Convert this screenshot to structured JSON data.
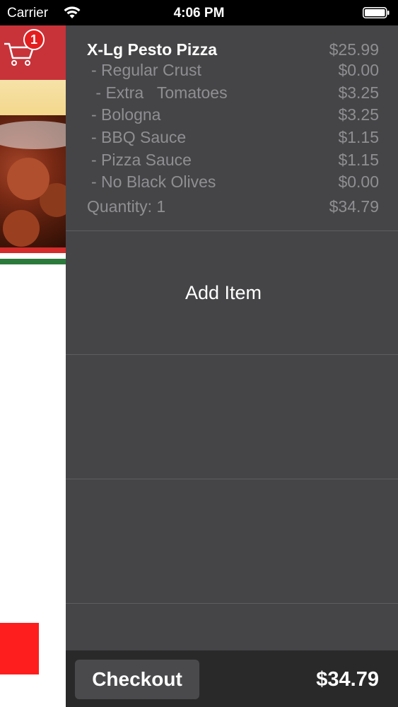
{
  "status_bar": {
    "carrier": "Carrier",
    "time": "4:06 PM"
  },
  "cart": {
    "badge_count": "1"
  },
  "order": {
    "item_name": "X-Lg Pesto Pizza",
    "item_price": "$25.99",
    "options": [
      {
        "label": " - Regular Crust",
        "price": "$0.00"
      },
      {
        "label": " - Extra   Tomatoes",
        "price": "$3.25"
      },
      {
        "label": " - Bologna",
        "price": "$3.25"
      },
      {
        "label": " - BBQ Sauce",
        "price": "$1.15"
      },
      {
        "label": " - Pizza Sauce",
        "price": "$1.15"
      },
      {
        "label": " - No Black Olives",
        "price": "$0.00"
      }
    ],
    "quantity_label": "Quantity: 1",
    "line_total": "$34.79"
  },
  "add_item_label": "Add Item",
  "footer": {
    "checkout_label": "Checkout",
    "total": "$34.79"
  },
  "colors": {
    "drawer_bg": "#454547",
    "footer_bg": "#29292a",
    "header_red": "#c8333a",
    "badge_red": "#e41e1e"
  }
}
